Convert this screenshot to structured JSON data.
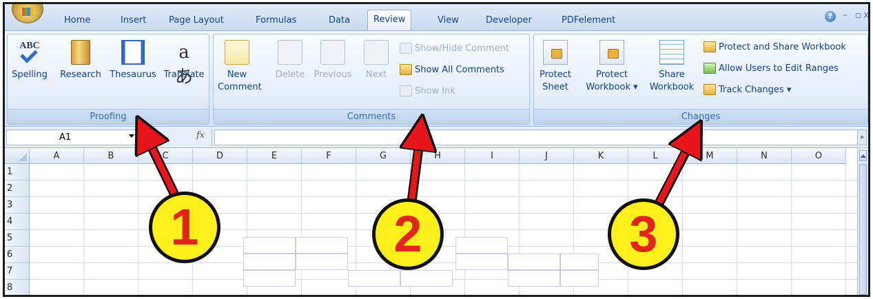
{
  "tabs": [
    {
      "label": "Home"
    },
    {
      "label": "Insert"
    },
    {
      "label": "Page Layout"
    },
    {
      "label": "Formulas"
    },
    {
      "label": "Data"
    },
    {
      "label": "Review",
      "active": true
    },
    {
      "label": "View"
    },
    {
      "label": "Developer"
    },
    {
      "label": "PDFelement"
    }
  ],
  "window_controls": {
    "help": "?",
    "minimize": "–",
    "restore": "▫",
    "close": "x"
  },
  "ribbon": {
    "proofing": {
      "label": "Proofing",
      "spelling_icon_text": "ABC",
      "spelling": "Spelling",
      "research": "Research",
      "thesaurus": "Thesaurus",
      "translate_icon_text": "aあ",
      "translate": "Translate"
    },
    "comments": {
      "label": "Comments",
      "new_line1": "New",
      "new_line2": "Comment",
      "delete": "Delete",
      "previous": "Previous",
      "next": "Next",
      "show_hide": "Show/Hide Comment",
      "show_all": "Show All Comments",
      "show_ink": "Show Ink"
    },
    "changes": {
      "label": "Changes",
      "protect_sheet_line1": "Protect",
      "protect_sheet_line2": "Sheet",
      "protect_workbook_line1": "Protect",
      "protect_workbook_line2": "Workbook ▾",
      "share_workbook_line1": "Share",
      "share_workbook_line2": "Workbook",
      "protect_share": "Protect and Share Workbook",
      "allow_users": "Allow Users to Edit Ranges",
      "track_changes": "Track Changes ▾"
    }
  },
  "formula_bar": {
    "name_box": "A1",
    "fx": "fx",
    "expand": "»"
  },
  "columns": [
    "A",
    "B",
    "C",
    "D",
    "E",
    "F",
    "G",
    "H",
    "I",
    "J",
    "K",
    "L",
    "M",
    "N",
    "O"
  ],
  "rows": [
    "1",
    "2",
    "3",
    "4",
    "5",
    "6",
    "7",
    "8"
  ],
  "callouts": [
    "1",
    "2",
    "3"
  ],
  "colors": {
    "arrow": "#e8151b",
    "badge_fill": "#ffef1a",
    "badge_text": "#e0261b",
    "ribbon_text": "#15428b"
  }
}
